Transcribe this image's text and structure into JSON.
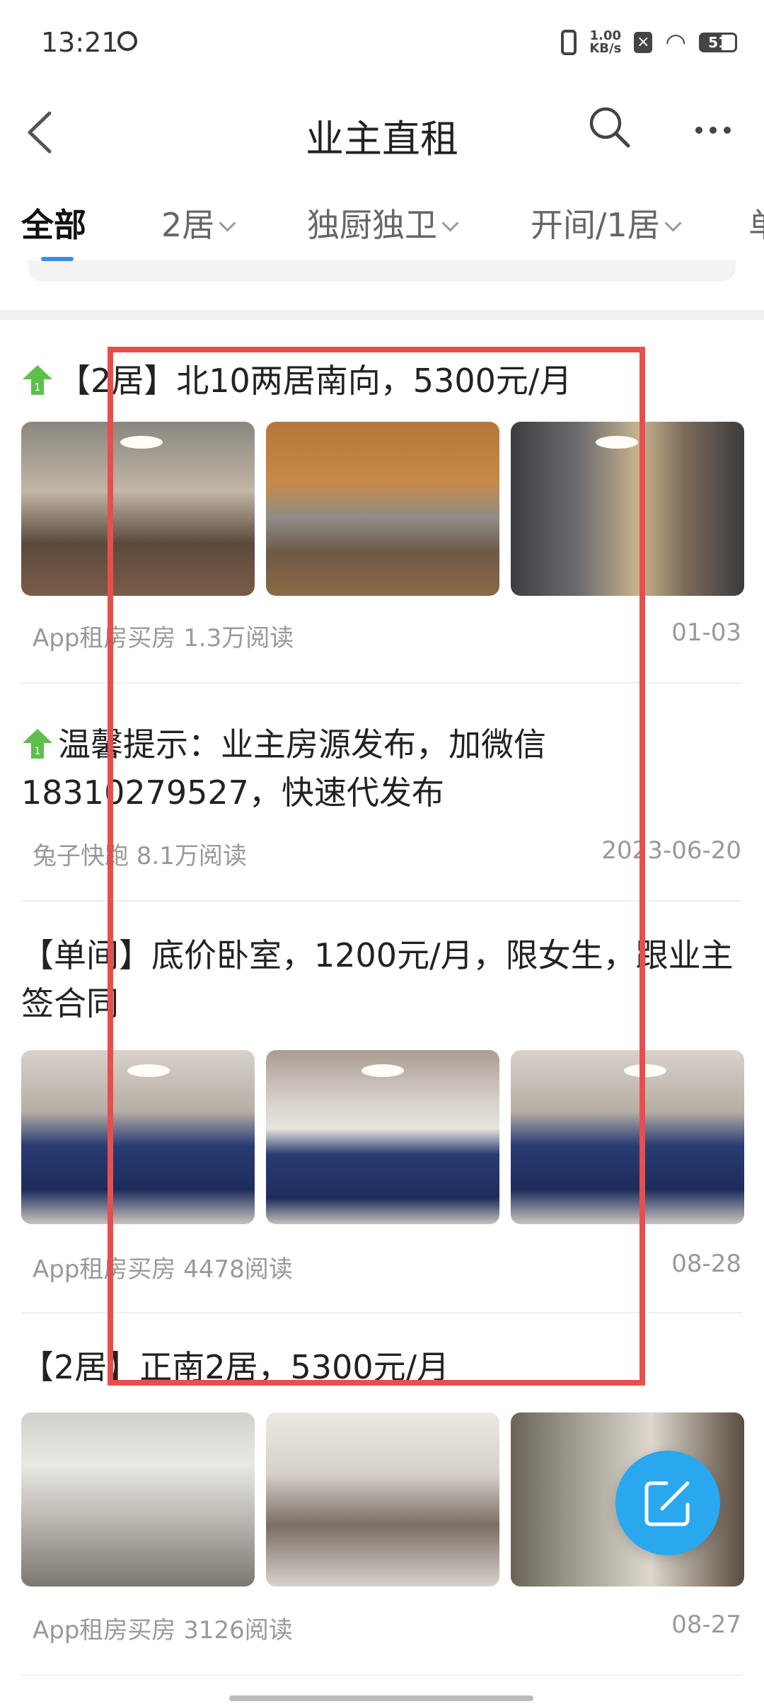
{
  "status": {
    "time": "13:21",
    "net_speed_value": "1.00",
    "net_speed_unit": "KB/s",
    "battery": "51"
  },
  "header": {
    "title": "业主直租"
  },
  "tabs": [
    {
      "label": "全部",
      "active": true,
      "dropdown": false
    },
    {
      "label": "2居",
      "active": false,
      "dropdown": true
    },
    {
      "label": "独厨独卫",
      "active": false,
      "dropdown": true
    },
    {
      "label": "开间/1居",
      "active": false,
      "dropdown": true
    },
    {
      "label": "单",
      "active": false,
      "dropdown": false
    }
  ],
  "posts": [
    {
      "title": "【2居】北10两居南向，5300元/月",
      "pinned": true,
      "source": "App租房买房 1.3万阅读",
      "date": "01-03"
    },
    {
      "title": "温馨提示：业主房源发布，加微信18310279527，快速代发布",
      "pinned": true,
      "source": "兔子快跑 8.1万阅读",
      "date": "2023-06-20"
    },
    {
      "title": "【单间】底价卧室，1200元/月，限女生，跟业主签合同",
      "pinned": false,
      "source": "App租房买房 4478阅读",
      "date": "08-28"
    },
    {
      "title": "【2居】正南2居，5300元/月",
      "pinned": false,
      "source": "App租房买房 3126阅读",
      "date": "08-27"
    }
  ],
  "colors": {
    "accent": "#3a8ee6",
    "fab": "#29a8f0",
    "highlight": "#e94e4e",
    "pin": "#5cc04a"
  }
}
